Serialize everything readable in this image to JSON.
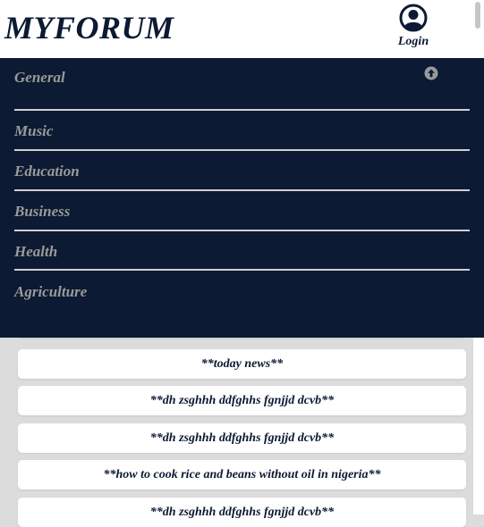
{
  "header": {
    "logo": "MYFORUM",
    "login_label": "Login",
    "login_icon": "user-circle-icon"
  },
  "menu": {
    "scroll_up_icon": "arrow-up-circle-icon",
    "items": [
      {
        "label": "General"
      },
      {
        "label": "Music"
      },
      {
        "label": "Education"
      },
      {
        "label": "Business"
      },
      {
        "label": "Health"
      },
      {
        "label": "Agriculture"
      }
    ]
  },
  "posts": [
    {
      "title": ""
    },
    {
      "title": "**today news**"
    },
    {
      "title": "**dh zsghhh ddfghhs fgnjjd dcvb**"
    },
    {
      "title": "**dh zsghhh ddfghhs fgnjjd dcvb**"
    },
    {
      "title": "**how to cook rice and beans without oil in nigeria**"
    },
    {
      "title": "**dh zsghhh ddfghhs fgnjjd dcvb**"
    }
  ],
  "colors": {
    "navy": "#0c1a33",
    "menu_text": "#9a9a9a",
    "page_bg": "#dcdcdc"
  }
}
